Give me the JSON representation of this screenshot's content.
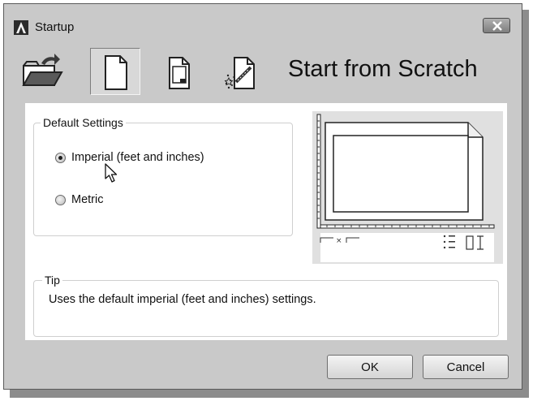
{
  "window": {
    "title": "Startup"
  },
  "toolbar": {
    "buttons": [
      {
        "icon": "open-folder-icon",
        "active": false
      },
      {
        "icon": "blank-page-icon",
        "active": true
      },
      {
        "icon": "template-page-icon",
        "active": false
      },
      {
        "icon": "wizard-page-icon",
        "active": false
      }
    ],
    "heading": "Start from Scratch"
  },
  "default_settings": {
    "legend": "Default Settings",
    "options": [
      {
        "label": "Imperial (feet and inches)",
        "checked": true
      },
      {
        "label": "Metric",
        "checked": false
      }
    ]
  },
  "preview": {
    "icon": "drawing-preview-icon",
    "x_symbol": "×"
  },
  "tip": {
    "legend": "Tip",
    "text": "Uses the default imperial (feet and inches) settings."
  },
  "buttons": {
    "ok": "OK",
    "cancel": "Cancel"
  },
  "colors": {
    "window_bg": "#c9c9c9",
    "panel_bg": "#ffffff",
    "preview_bg": "#e0e0e0"
  }
}
